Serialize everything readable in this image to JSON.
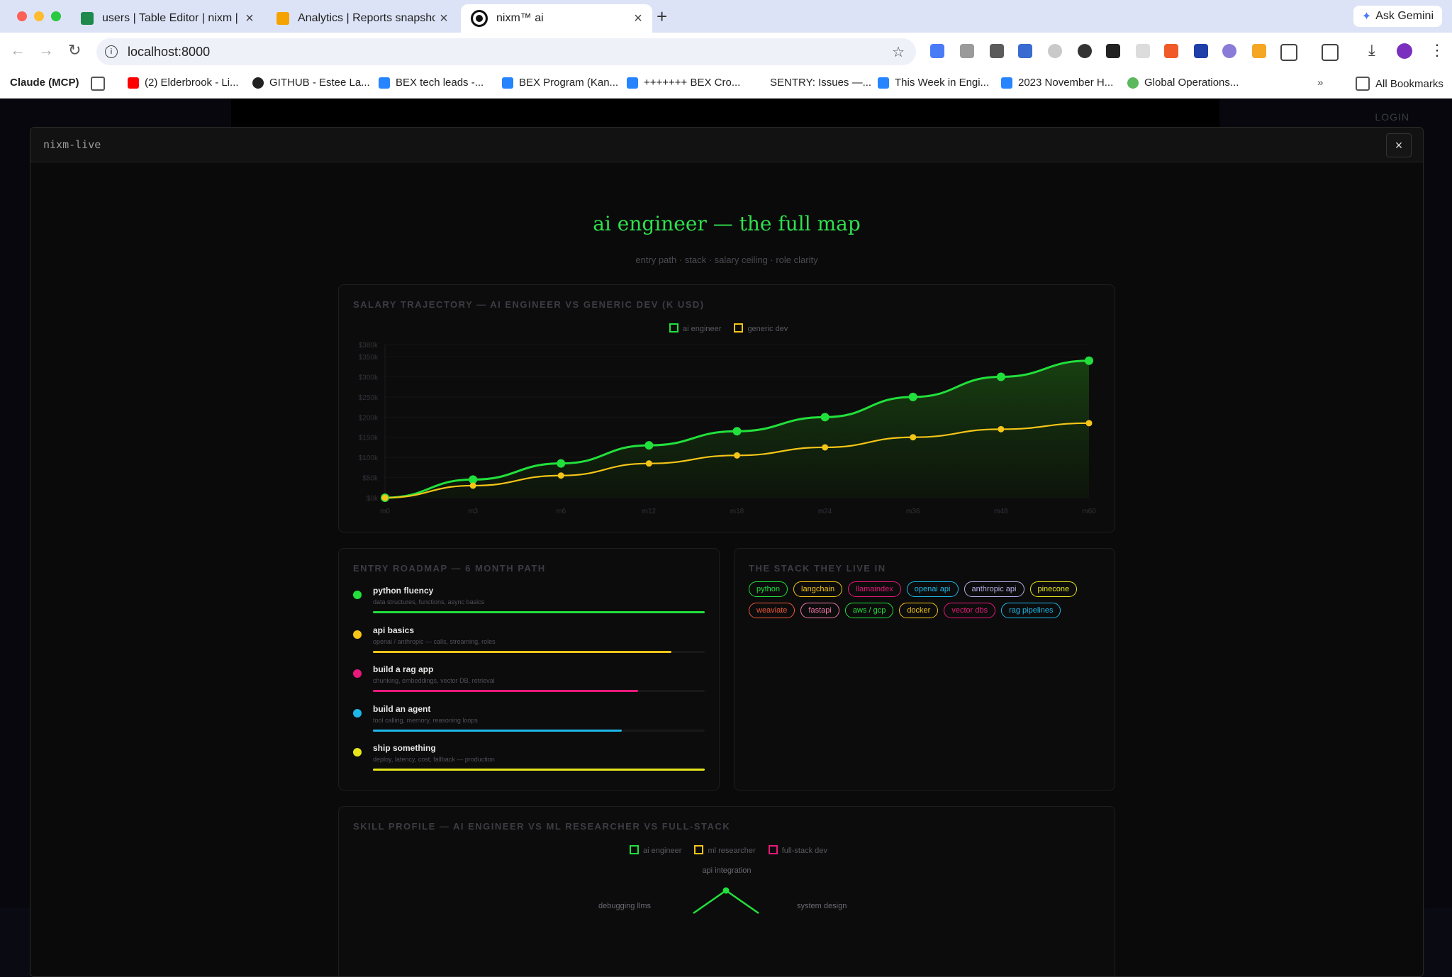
{
  "browser": {
    "tabs": [
      {
        "label": "users | Table Editor | nixm | tu",
        "icon_color": "#1f8a4c"
      },
      {
        "label": "Analytics | Reports snapshot",
        "icon_color": "#f4a300"
      },
      {
        "label": "nixm™ ai",
        "icon_color": "#111111"
      }
    ],
    "ask_gemini": "Ask Gemini",
    "url": "localhost:8000",
    "bookmarks": [
      {
        "label": "Claude (MCP)"
      },
      {
        "label": "(2) Elderbrook - Li..."
      },
      {
        "label": "GITHUB - Estee La..."
      },
      {
        "label": "BEX tech leads -..."
      },
      {
        "label": "BEX Program (Kan..."
      },
      {
        "label": "+++++++ BEX Cro..."
      },
      {
        "label": "SENTRY: Issues —..."
      },
      {
        "label": "This Week in Engi..."
      },
      {
        "label": "2023 November H..."
      },
      {
        "label": "Global Operations..."
      }
    ],
    "all_bookmarks": "All Bookmarks"
  },
  "page": {
    "login": "LOGIN"
  },
  "modal": {
    "title": "nixm-live",
    "close": "×",
    "heading": "ai engineer — the full map",
    "subheading": "entry path · stack · salary ceiling · role clarity"
  },
  "salary_card": {
    "title": "SALARY TRAJECTORY — AI ENGINEER VS GENERIC DEV (K USD)"
  },
  "chart_data": {
    "type": "line",
    "title": "SALARY TRAJECTORY — AI ENGINEER VS GENERIC DEV (K USD)",
    "categories": [
      "m0",
      "m3",
      "m6",
      "m12",
      "m18",
      "m24",
      "m36",
      "m48",
      "m60"
    ],
    "y_ticks": [
      "$0k",
      "$50k",
      "$100k",
      "$150k",
      "$200k",
      "$250k",
      "$300k",
      "$350k",
      "$380k"
    ],
    "y_tick_values": [
      0,
      50,
      100,
      150,
      200,
      250,
      300,
      350,
      380
    ],
    "ylim": [
      0,
      380
    ],
    "legend_position": "top-center",
    "series": [
      {
        "name": "ai engineer",
        "color": "#22e03c",
        "values": [
          0,
          45,
          85,
          130,
          165,
          200,
          250,
          300,
          340
        ],
        "filled": true
      },
      {
        "name": "generic dev",
        "color": "#f5c518",
        "values": [
          0,
          30,
          55,
          85,
          105,
          125,
          150,
          170,
          185
        ],
        "filled": false
      }
    ]
  },
  "roadmap": {
    "title": "ENTRY ROADMAP — 6 MONTH PATH",
    "items": [
      {
        "title": "python fluency",
        "desc": "data structures, functions, async basics",
        "color": "#22e03c",
        "progress": 1.0
      },
      {
        "title": "api basics",
        "desc": "openai / anthropic — calls, streaming, roles",
        "color": "#f5c518",
        "progress": 0.9
      },
      {
        "title": "build a rag app",
        "desc": "chunking, embeddings, vector DB, retrieval",
        "color": "#e8197a",
        "progress": 0.8
      },
      {
        "title": "build an agent",
        "desc": "tool calling, memory, reasoning loops",
        "color": "#1eb8e8",
        "progress": 0.75
      },
      {
        "title": "ship something",
        "desc": "deploy, latency, cost, fallback — production",
        "color": "#e6e61c",
        "progress": 1.0
      }
    ]
  },
  "stack": {
    "title": "THE STACK THEY LIVE IN",
    "chips": [
      {
        "label": "python",
        "color": "#22e03c"
      },
      {
        "label": "langchain",
        "color": "#f5c518"
      },
      {
        "label": "llamaindex",
        "color": "#e8197a"
      },
      {
        "label": "openai api",
        "color": "#1eb8e8"
      },
      {
        "label": "anthropic api",
        "color": "#b8b0e8"
      },
      {
        "label": "pinecone",
        "color": "#e6e61c"
      },
      {
        "label": "weaviate",
        "color": "#f0583a"
      },
      {
        "label": "fastapi",
        "color": "#f07aa8"
      },
      {
        "label": "aws / gcp",
        "color": "#22e03c"
      },
      {
        "label": "docker",
        "color": "#f5c518"
      },
      {
        "label": "vector dbs",
        "color": "#e8197a"
      },
      {
        "label": "rag pipelines",
        "color": "#1eb8e8"
      }
    ]
  },
  "skills": {
    "title": "SKILL PROFILE — AI ENGINEER VS ML RESEARCHER VS FULL-STACK",
    "legend": [
      {
        "name": "ai engineer",
        "color": "#22e03c"
      },
      {
        "name": "ml researcher",
        "color": "#f5c518"
      },
      {
        "name": "full-stack dev",
        "color": "#e8197a"
      }
    ],
    "axis_labels": [
      "api integration",
      "debugging llms",
      "system design"
    ]
  }
}
